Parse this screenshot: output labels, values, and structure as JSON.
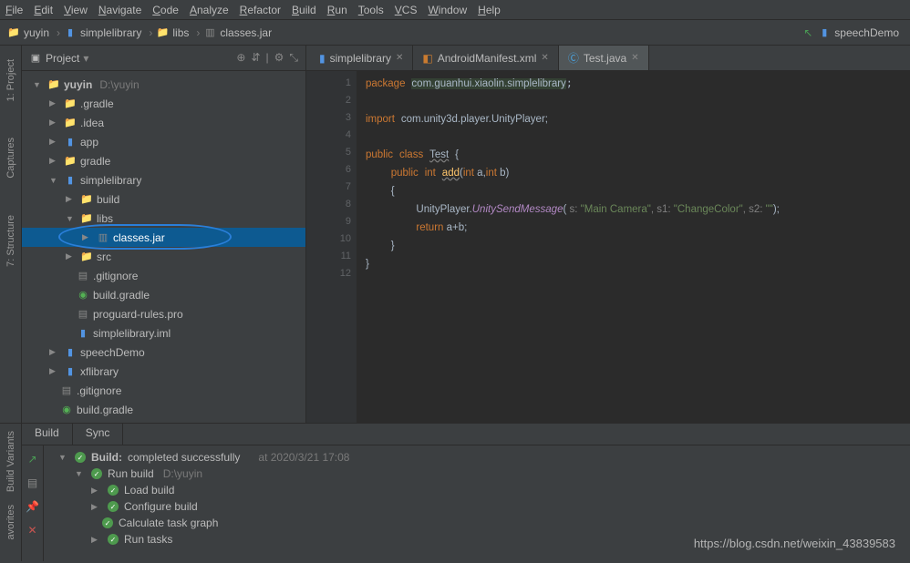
{
  "menubar": [
    "File",
    "Edit",
    "View",
    "Navigate",
    "Code",
    "Analyze",
    "Refactor",
    "Build",
    "Run",
    "Tools",
    "VCS",
    "Window",
    "Help"
  ],
  "breadcrumb": {
    "items": [
      "yuyin",
      "simplelibrary",
      "libs",
      "classes.jar"
    ],
    "right": "speechDemo"
  },
  "project_panel": {
    "title": "Project",
    "root_name": "yuyin",
    "root_path": "D:\\yuyin",
    "items": {
      "gradle_dir": ".gradle",
      "idea_dir": ".idea",
      "app": "app",
      "gradle": "gradle",
      "simplelibrary": "simplelibrary",
      "build": "build",
      "libs": "libs",
      "classes_jar": "classes.jar",
      "src": "src",
      "gitignore": ".gitignore",
      "build_gradle": "build.gradle",
      "proguard": "proguard-rules.pro",
      "iml": "simplelibrary.iml",
      "speechDemo": "speechDemo",
      "xflibrary": "xflibrary",
      "gitignore2": ".gitignore",
      "build_gradle2": "build.gradle"
    }
  },
  "tabs": [
    {
      "label": "simplelibrary",
      "icon": "module",
      "active": false
    },
    {
      "label": "AndroidManifest.xml",
      "icon": "xml",
      "active": false
    },
    {
      "label": "Test.java",
      "icon": "class",
      "active": true
    }
  ],
  "code_lines": {
    "l1_pkg": "package",
    "l1_path": "com.guanhui.xiaolin.simplelibrary",
    "l3_import": "import",
    "l3_path": "com.unity3d.player.UnityPlayer;",
    "l5_a": "public",
    "l5_b": "class",
    "l5_c": "Test",
    "l5_d": "{",
    "l6_a": "public",
    "l6_b": "int",
    "l6_c": "add",
    "l6_d": "(",
    "l6_e": "int",
    "l6_f": " a,",
    "l6_g": "int",
    "l6_h": " b)",
    "l7": "{",
    "l8_a": "UnityPlayer.",
    "l8_b": "UnitySendMessage",
    "l8_c": "(",
    "l8_s": " s: ",
    "l8_str1": "\"Main Camera\"",
    "l8_s1": ", s1: ",
    "l8_str2": "\"ChangeColor\"",
    "l8_s2": ", s2: ",
    "l8_str3": "\"\"",
    "l8_end": ");",
    "l9_a": "return",
    "l9_b": " a+b;",
    "l10": "}",
    "l11": "}"
  },
  "build": {
    "tabs": [
      "Build",
      "Sync"
    ],
    "title_strong": "Build:",
    "title_rest": " completed successfully",
    "timestamp": "at 2020/3/21 17:08",
    "run_build": "Run build",
    "run_build_path": "D:\\yuyin",
    "rows": [
      "Load build",
      "Configure build",
      "Calculate task graph",
      "Run tasks"
    ]
  },
  "watermark": "https://blog.csdn.net/weixin_43839583",
  "sidebar_left": [
    "1: Project",
    "Captures",
    "7: Structure"
  ],
  "build_sidebar": [
    "Build Variants",
    "avorites"
  ]
}
